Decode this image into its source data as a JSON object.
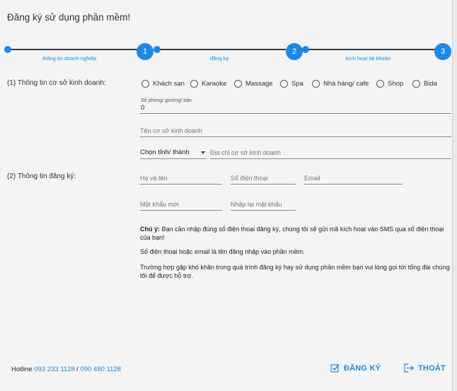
{
  "window": {
    "title": "Đăng ký sử dụng phần mềm!"
  },
  "stepper": {
    "steps": [
      {
        "number": "1",
        "label": "thông tin doanh nghiệp"
      },
      {
        "number": "2",
        "label": "đăng ký"
      },
      {
        "number": "3",
        "label": "kích hoạt tài khoản"
      }
    ]
  },
  "business": {
    "section_label": "(1) Thông tin cơ sở kinh doanh:",
    "types": [
      "Khách sạn",
      "Karaoke",
      "Massage",
      "Spa",
      "Nhà hàng/ cafe",
      "Shop",
      "Bida"
    ],
    "rooms_label": "Số phòng/ giường/ bàn",
    "rooms_value": "0",
    "name_placeholder": "Tên cơ sở kinh doanh",
    "province_selected": "Chọn tỉnh/ thành",
    "address_placeholder": "Địa chỉ cơ sở kinh doanh"
  },
  "registration": {
    "section_label": "(2) Thông tin đăng ký:",
    "fullname_placeholder": "Họ và tên",
    "phone_placeholder": "Số điện thoại",
    "email_placeholder": "Email",
    "password_placeholder": "Mật khẩu mới",
    "confirm_placeholder": "Nhập lại mật khẩu"
  },
  "notes": {
    "note_prefix": "Chú ý:",
    "note_text": " Bạn cần nhập đúng số điện thoại đăng ký, chúng tôi sẽ gửi mã kích hoạt vào SMS qua số điện thoại của bạn!",
    "login_note": "Số điện thoại hoặc email là tên đăng nhập vào phần mềm.",
    "support_note": "Trường hợp gặp khó khăn trong quá trình đăng ký hay sử dụng phần mềm bạn vui lòng gọi tới tổng đài chúng tôi để được hỗ trợ."
  },
  "footer": {
    "hotline_label": "Hotline",
    "hotline_1": "093 233 1128",
    "separator": "/",
    "hotline_2": "090 480 1128",
    "register_button": "ĐĂNG KÝ",
    "exit_button": "THOÁT"
  },
  "colors": {
    "accent": "#1e88e5",
    "background": "#f4f4f4"
  }
}
